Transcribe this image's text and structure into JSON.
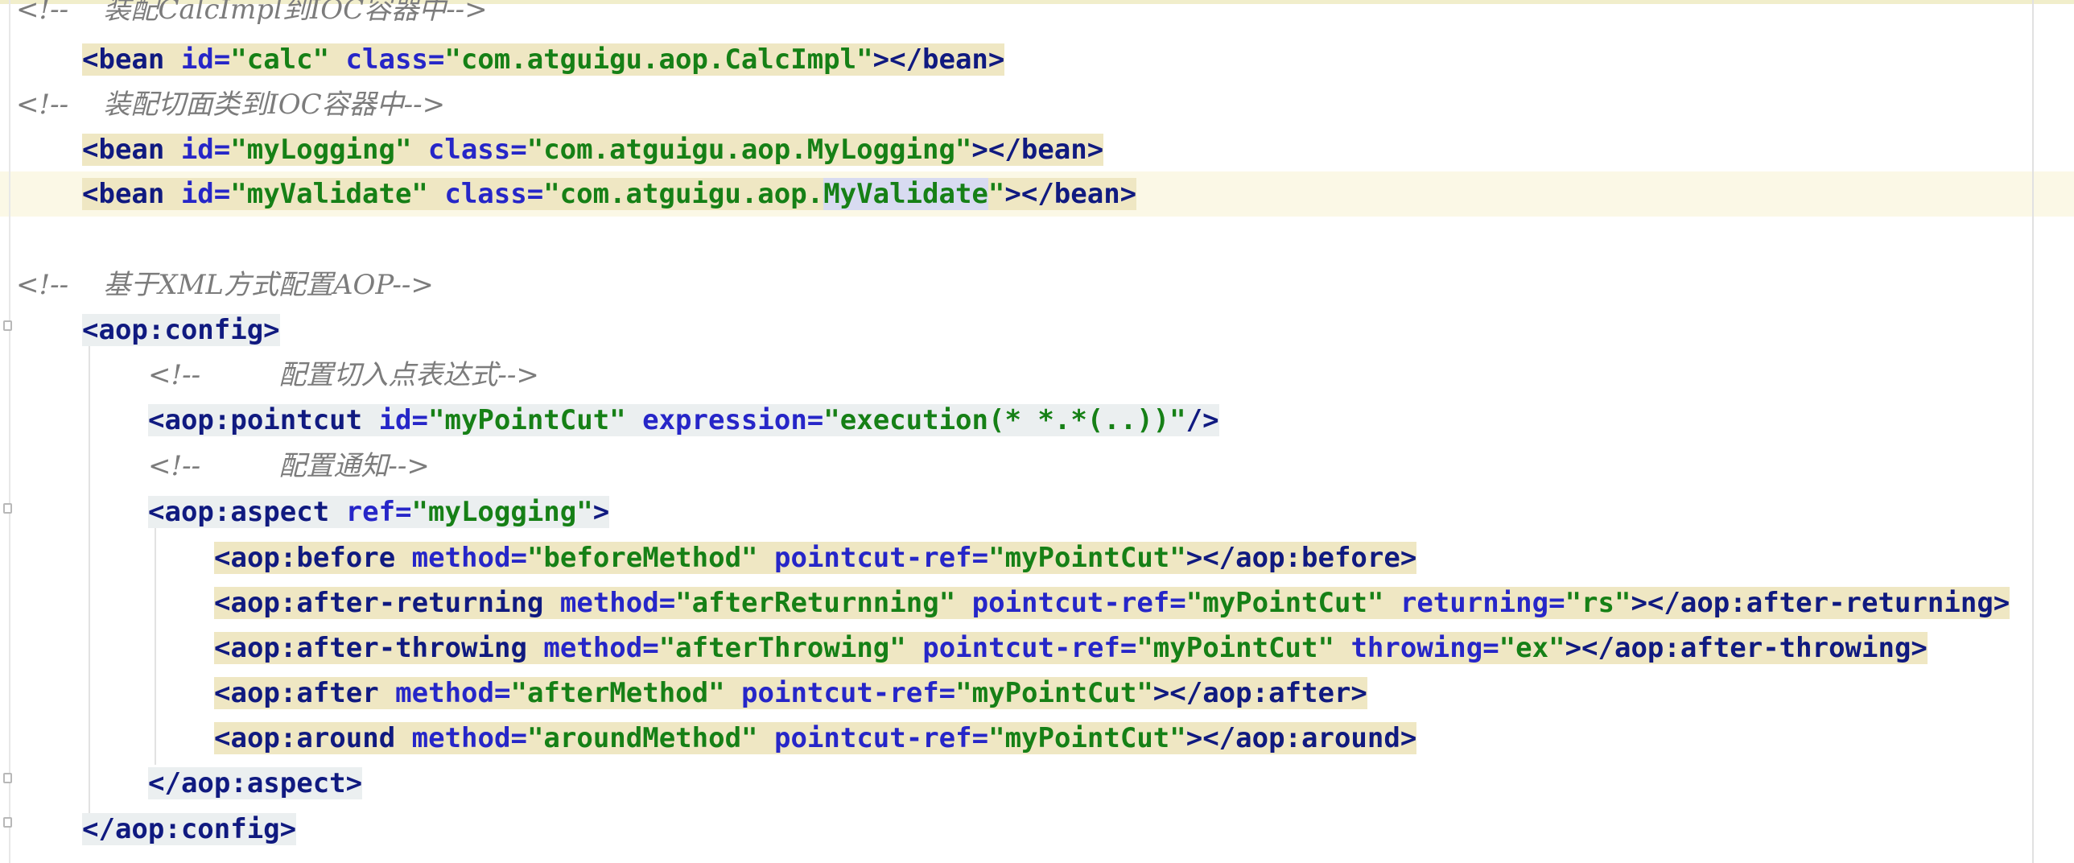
{
  "lines": [
    [
      {
        "t": "<!--    装配CalcImpl到IOC容器中-->",
        "c": "cmt"
      }
    ],
    [
      {
        "t": "<bean ",
        "c": "tag"
      },
      {
        "t": "id=",
        "c": "attr"
      },
      {
        "t": "\"calc\" ",
        "c": "val"
      },
      {
        "t": "class=",
        "c": "attr"
      },
      {
        "t": "\"com.atguigu.aop.CalcImpl\"",
        "c": "val"
      },
      {
        "t": "></bean>",
        "c": "tag"
      }
    ],
    [
      {
        "t": "<!--    装配切面类到IOC容器中-->",
        "c": "cmt"
      }
    ],
    [
      {
        "t": "<bean ",
        "c": "tag"
      },
      {
        "t": "id=",
        "c": "attr"
      },
      {
        "t": "\"myLogging\" ",
        "c": "val"
      },
      {
        "t": "class=",
        "c": "attr"
      },
      {
        "t": "\"com.atguigu.aop.MyLogging\"",
        "c": "val"
      },
      {
        "t": "></bean>",
        "c": "tag"
      }
    ],
    [
      {
        "t": "<bean ",
        "c": "tag"
      },
      {
        "t": "id=",
        "c": "attr"
      },
      {
        "t": "\"myValidate\" ",
        "c": "val"
      },
      {
        "t": "class=",
        "c": "attr"
      },
      {
        "t": "\"com.atguigu.aop.",
        "c": "val"
      },
      {
        "t": "MyValidate",
        "c": "val sel"
      },
      {
        "t": "\"",
        "c": "val"
      },
      {
        "t": "></bean>",
        "c": "tag"
      }
    ],
    [],
    [
      {
        "t": "<!--    基于XML方式配置AOP-->",
        "c": "cmt"
      }
    ],
    [
      {
        "t": "<aop:config>",
        "c": "tag"
      }
    ],
    [
      {
        "t": "<!--         配置切入点表达式-->",
        "c": "cmt"
      }
    ],
    [
      {
        "t": "<aop:pointcut ",
        "c": "tag"
      },
      {
        "t": "id=",
        "c": "attr"
      },
      {
        "t": "\"myPointCut\" ",
        "c": "val"
      },
      {
        "t": "expression=",
        "c": "attr"
      },
      {
        "t": "\"execution(* *.*(..))\"",
        "c": "val"
      },
      {
        "t": "/>",
        "c": "tag"
      }
    ],
    [
      {
        "t": "<!--         配置通知-->",
        "c": "cmt"
      }
    ],
    [
      {
        "t": "<aop:aspect ",
        "c": "tag"
      },
      {
        "t": "ref=",
        "c": "attr"
      },
      {
        "t": "\"myLogging\"",
        "c": "val"
      },
      {
        "t": ">",
        "c": "tag"
      }
    ],
    [
      {
        "t": "<aop:before ",
        "c": "tag"
      },
      {
        "t": "method=",
        "c": "attr"
      },
      {
        "t": "\"beforeMethod\" ",
        "c": "val"
      },
      {
        "t": "pointcut-ref=",
        "c": "attr"
      },
      {
        "t": "\"myPointCut\"",
        "c": "val"
      },
      {
        "t": "></aop:before>",
        "c": "tag"
      }
    ],
    [
      {
        "t": "<aop:after-returning ",
        "c": "tag"
      },
      {
        "t": "method=",
        "c": "attr"
      },
      {
        "t": "\"afterReturnning\" ",
        "c": "val"
      },
      {
        "t": "pointcut-ref=",
        "c": "attr"
      },
      {
        "t": "\"myPointCut\" ",
        "c": "val"
      },
      {
        "t": "returning=",
        "c": "attr"
      },
      {
        "t": "\"rs\"",
        "c": "val"
      },
      {
        "t": "></aop:after-returning>",
        "c": "tag"
      }
    ],
    [
      {
        "t": "<aop:after-throwing ",
        "c": "tag"
      },
      {
        "t": "method=",
        "c": "attr"
      },
      {
        "t": "\"afterThrowing\" ",
        "c": "val"
      },
      {
        "t": "pointcut-ref=",
        "c": "attr"
      },
      {
        "t": "\"myPointCut\" ",
        "c": "val"
      },
      {
        "t": "throwing=",
        "c": "attr"
      },
      {
        "t": "\"ex\"",
        "c": "val"
      },
      {
        "t": "></aop:after-throwing>",
        "c": "tag"
      }
    ],
    [
      {
        "t": "<aop:after ",
        "c": "tag"
      },
      {
        "t": "method=",
        "c": "attr"
      },
      {
        "t": "\"afterMethod\" ",
        "c": "val"
      },
      {
        "t": "pointcut-ref=",
        "c": "attr"
      },
      {
        "t": "\"myPointCut\"",
        "c": "val"
      },
      {
        "t": "></aop:after>",
        "c": "tag"
      }
    ],
    [
      {
        "t": "<aop:around ",
        "c": "tag"
      },
      {
        "t": "method=",
        "c": "attr"
      },
      {
        "t": "\"aroundMethod\" ",
        "c": "val"
      },
      {
        "t": "pointcut-ref=",
        "c": "attr"
      },
      {
        "t": "\"myPointCut\"",
        "c": "val"
      },
      {
        "t": "></aop:around>",
        "c": "tag"
      }
    ],
    [
      {
        "t": "</aop:aspect>",
        "c": "tag"
      }
    ],
    [
      {
        "t": "</aop:config>",
        "c": "tag"
      }
    ]
  ],
  "current_line": 4
}
